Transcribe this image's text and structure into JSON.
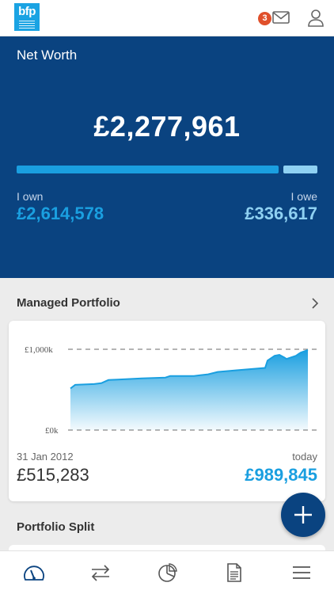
{
  "header": {
    "logo_text": "bfp",
    "notification_count": "3",
    "icons": [
      "mail-icon",
      "user-icon"
    ]
  },
  "net_worth": {
    "title": "Net Worth",
    "total": "£2,277,961",
    "own_label": "I own",
    "own_value": "£2,614,578",
    "owe_label": "I owe",
    "owe_value": "£336,617",
    "own_fraction": 0.886,
    "colors": {
      "panel": "#0a4380",
      "own": "#1a9fe0",
      "owe": "#8fd1f2"
    }
  },
  "managed_portfolio": {
    "title": "Managed Portfolio",
    "start_date": "31 Jan 2012",
    "start_value": "£515,283",
    "end_label": "today",
    "end_value": "£989,845"
  },
  "chart_data": {
    "type": "area",
    "ylim": [
      0,
      1000
    ],
    "ytick_labels": [
      "£1,000k",
      "£0k"
    ],
    "x": [
      0,
      0.02,
      0.1,
      0.13,
      0.16,
      0.2,
      0.3,
      0.4,
      0.42,
      0.52,
      0.58,
      0.62,
      0.7,
      0.82,
      0.83,
      0.86,
      0.88,
      0.9,
      0.91,
      0.93,
      0.95,
      0.96,
      0.97,
      1.0
    ],
    "values": [
      515,
      560,
      570,
      580,
      620,
      625,
      640,
      650,
      670,
      670,
      690,
      720,
      740,
      770,
      860,
      920,
      930,
      900,
      880,
      900,
      920,
      940,
      960,
      990
    ],
    "xlabel": "",
    "ylabel": "",
    "grid": "horizontal dashed at ticks",
    "color": "#1a9fe0"
  },
  "portfolio_split": {
    "title": "Portfolio Split"
  },
  "fab": {
    "icon": "plus-icon"
  },
  "bottom_nav": [
    {
      "name": "nav-dashboard",
      "icon": "speedometer-icon"
    },
    {
      "name": "nav-transactions",
      "icon": "transfer-arrows-icon"
    },
    {
      "name": "nav-allocation",
      "icon": "pie-chart-icon"
    },
    {
      "name": "nav-documents",
      "icon": "document-icon"
    },
    {
      "name": "nav-menu",
      "icon": "hamburger-menu-icon"
    }
  ]
}
